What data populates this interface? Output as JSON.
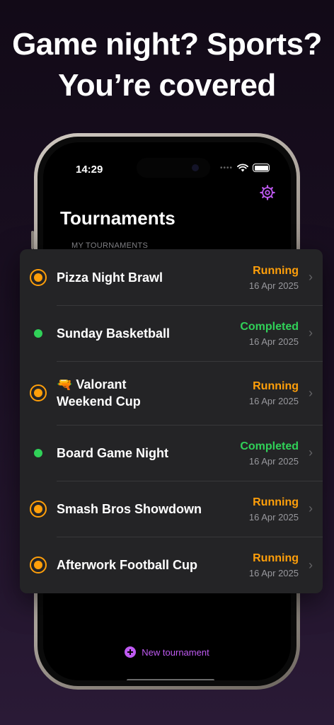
{
  "headline": {
    "line1": "Game night? Sports?",
    "line2": "You’re covered"
  },
  "status_bar": {
    "time": "14:29",
    "signal_icon": "signal-dots-icon",
    "wifi_icon": "wifi-icon",
    "battery_icon": "battery-icon"
  },
  "app": {
    "title": "Tournaments",
    "settings_icon": "gear-icon",
    "section_label": "MY TOURNAMENTS",
    "tournaments": [
      {
        "name": "Pizza Night Brawl",
        "status": "Running",
        "date": "16 Apr 2025",
        "state_icon": "running-ring-icon"
      },
      {
        "name": "Sunday Basketball",
        "status": "Completed",
        "date": "16 Apr 2025",
        "state_icon": "completed-dot-icon"
      },
      {
        "name_line1": "🔫 Valorant",
        "name_line2": "Weekend Cup",
        "status": "Running",
        "date": "16 Apr 2025",
        "state_icon": "running-ring-icon"
      },
      {
        "name": "Board Game Night",
        "status": "Completed",
        "date": "16 Apr 2025",
        "state_icon": "completed-dot-icon"
      },
      {
        "name": "Smash Bros Showdown",
        "status": "Running",
        "date": "16 Apr 2025",
        "state_icon": "running-ring-icon"
      },
      {
        "name": "Afterwork Football Cup",
        "status": "Running",
        "date": "16 Apr 2025",
        "state_icon": "running-ring-icon"
      }
    ],
    "new_tournament_label": "New tournament",
    "chevron_icon": "chevron-right-icon"
  },
  "colors": {
    "running": "#ff9f0a",
    "completed": "#30d158",
    "accent": "#bf5af2",
    "card_bg": "#242426"
  }
}
